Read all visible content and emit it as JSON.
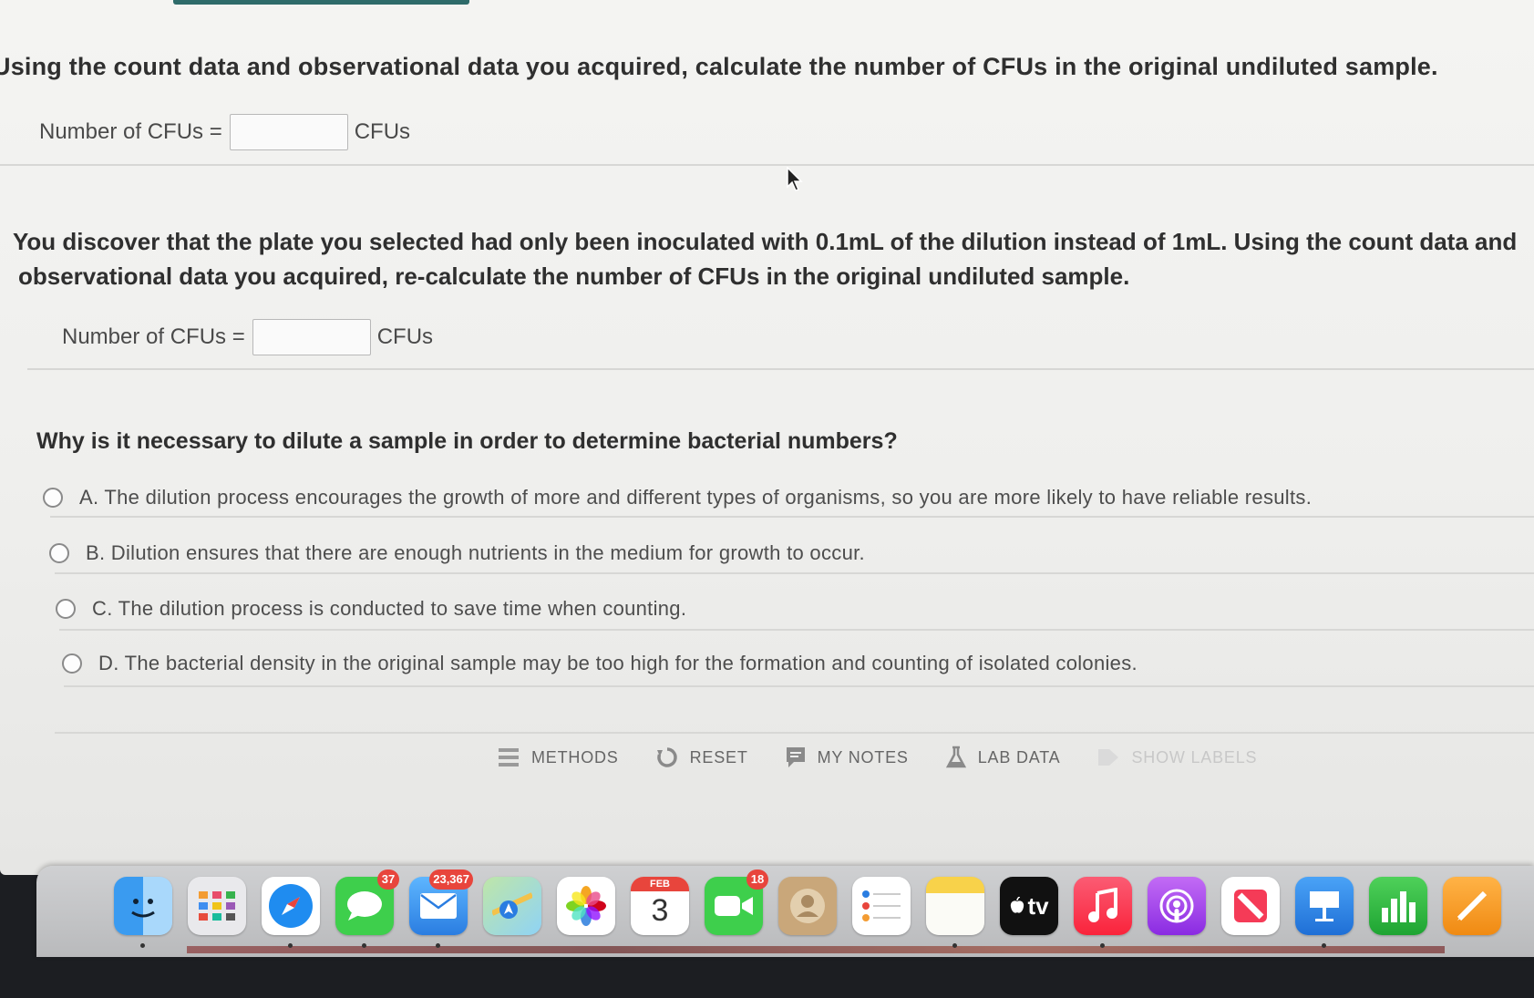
{
  "question1": {
    "text": "Using the count data and observational data you acquired, calculate the number of CFUs in the original undiluted sample.",
    "label": "Number of CFUs =",
    "unit": "CFUs",
    "value": ""
  },
  "question2": {
    "line1": "You discover that the plate you selected had only been inoculated with 0.1mL of the dilution instead of 1mL. Using the count data and",
    "line2": "observational data you acquired, re-calculate the number of CFUs in the original undiluted sample.",
    "label": "Number of CFUs =",
    "unit": "CFUs",
    "value": ""
  },
  "question3": {
    "text": "Why is it necessary to dilute a sample in order to determine bacterial numbers?",
    "options": [
      {
        "label": "A. The dilution process encourages the growth of more and different types of organisms, so you are more likely to have reliable results."
      },
      {
        "label": "B. Dilution ensures that there are enough nutrients in the medium for growth to occur."
      },
      {
        "label": "C. The dilution process is conducted to save time when counting."
      },
      {
        "label": "D. The bacterial density in the original sample may be too high for the formation and counting of isolated colonies."
      }
    ]
  },
  "toolbar": {
    "methods": "METHODS",
    "reset": "RESET",
    "my_notes": "MY NOTES",
    "lab_data": "LAB DATA",
    "show_labels": "SHOW LABELS"
  },
  "dock": {
    "messages_badge": "37",
    "mail_badge": "23,367",
    "calendar_month": "FEB",
    "calendar_day": "3",
    "facetime_badge": "18",
    "tv_label": "tv"
  },
  "colors": {
    "accent": "#2e6b6a",
    "text_dark": "#2f2f2f",
    "badge_red": "#e8453c"
  }
}
